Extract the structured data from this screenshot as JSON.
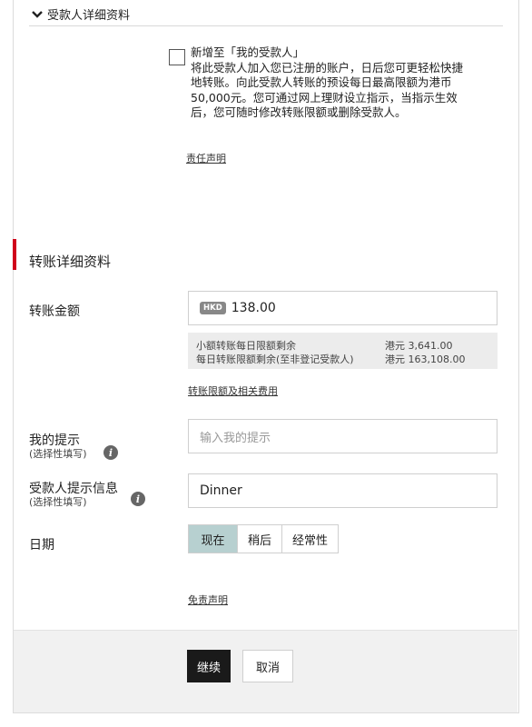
{
  "payee_section": {
    "title": "受款人详细资料",
    "add_payee_title": "新增至「我的受款人」",
    "add_payee_desc": "将此受款人加入您已注册的账户，日后您可更轻松快捷地转账。向此受款人转账的预设每日最高限额为港币50,000元。您可通过网上理财设立指示，当指示生效后，您可随时修改转账限额或删除受款人。",
    "disclaimer_link": "责任声明"
  },
  "transfer_section": {
    "title": "转账详细资料",
    "amount_label": "转账金额",
    "currency": "HKD",
    "amount_value": "138.00",
    "limits": {
      "small_label": "小额转账每日限额剩余",
      "small_value": "港元 3,641.00",
      "daily_label": "每日转账限额剩余(至非登记受款人)",
      "daily_value": "港元 163,108.00"
    },
    "limits_link": "转账限额及相关费用",
    "my_reminder_label": "我的提示",
    "my_reminder_sub": "(选择性填写)",
    "my_reminder_placeholder": "输入我的提示",
    "payee_reminder_label": "受款人提示信息",
    "payee_reminder_sub": "(选择性填写)",
    "payee_reminder_value": "Dinner",
    "date_label": "日期",
    "date_options": [
      "现在",
      "稍后",
      "经常性"
    ],
    "date_selected": "现在",
    "exemption_link": "免责声明"
  },
  "footer": {
    "continue_label": "继续",
    "cancel_label": "取消"
  },
  "colors": {
    "accent_red": "#d0021b",
    "selected_seg": "#b7d0d0",
    "primary_btn": "#1a1a1a"
  }
}
